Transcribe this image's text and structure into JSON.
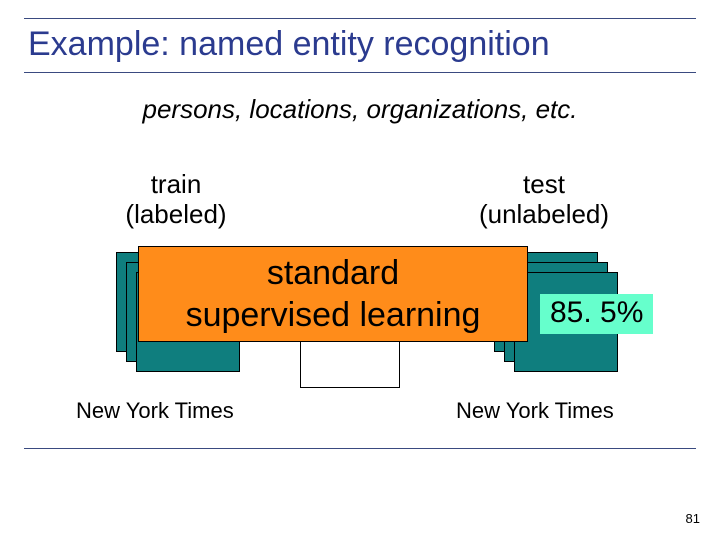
{
  "title": "Example: named entity recognition",
  "subtitle": "persons, locations, organizations, etc.",
  "columns": {
    "left": {
      "heading_line1": "train",
      "heading_line2": "(labeled)",
      "source": "New York Times"
    },
    "right": {
      "heading_line1": "test",
      "heading_line2": "(unlabeled)",
      "source": "New York Times"
    }
  },
  "overlay": {
    "line1": "standard",
    "line2": "supervised learning"
  },
  "accuracy_label": "85. 5%",
  "page_number": "81"
}
